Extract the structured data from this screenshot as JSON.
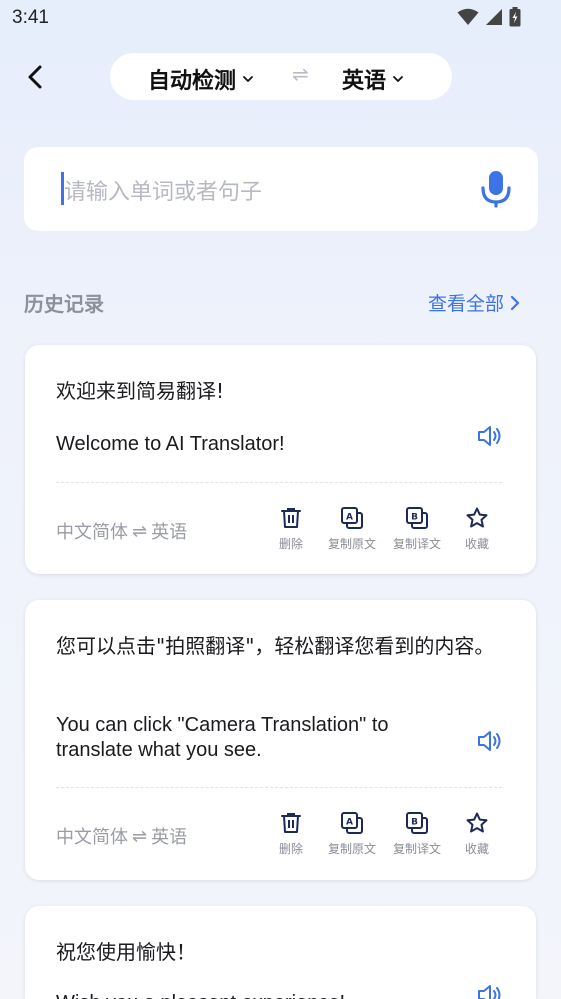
{
  "status": {
    "time": "3:41"
  },
  "header": {
    "source_lang": "自动检测",
    "swap_symbol": "⇌",
    "target_lang": "英语"
  },
  "search": {
    "placeholder": "请输入单词或者句子"
  },
  "history": {
    "title": "历史记录",
    "view_all": "查看全部"
  },
  "actions": {
    "delete": "删除",
    "copy_source": "复制原文",
    "copy_translation": "复制译文",
    "favorite": "收藏"
  },
  "cards": [
    {
      "source": "欢迎来到简易翻译!",
      "translation": "Welcome to AI Translator!",
      "pair_from": "中文简体",
      "pair_swap": "⇌",
      "pair_to": "英语"
    },
    {
      "source": "您可以点击\"拍照翻译\"，轻松翻译您看到的内容。",
      "translation": "You can click \"Camera Translation\" to translate what you see.",
      "pair_from": "中文简体",
      "pair_swap": "⇌",
      "pair_to": "英语"
    },
    {
      "source": "祝您使用愉快！",
      "translation": "Wish you a pleasant experience!"
    }
  ],
  "colors": {
    "accent": "#3d73e6",
    "icon_dark": "#1d2a57"
  }
}
